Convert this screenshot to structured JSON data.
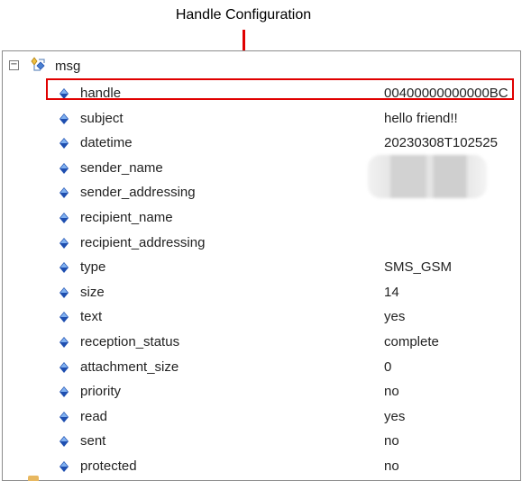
{
  "annotation": {
    "title": "Handle Configuration"
  },
  "tree": {
    "expander_symbol": "−",
    "root_label": "msg",
    "root_icon": "tree-node-icon",
    "property_icon": "blue-diamond-icon",
    "properties": [
      {
        "key": "handle",
        "value": "00400000000000BC",
        "highlighted": true
      },
      {
        "key": "subject",
        "value": "hello friend!!"
      },
      {
        "key": "datetime",
        "value": "20230308T102525"
      },
      {
        "key": "sender_name",
        "value": ""
      },
      {
        "key": "sender_addressing",
        "value": ""
      },
      {
        "key": "recipient_name",
        "value": ""
      },
      {
        "key": "recipient_addressing",
        "value": ""
      },
      {
        "key": "type",
        "value": "SMS_GSM"
      },
      {
        "key": "size",
        "value": "14"
      },
      {
        "key": "text",
        "value": "yes"
      },
      {
        "key": "reception_status",
        "value": "complete"
      },
      {
        "key": "attachment_size",
        "value": "0"
      },
      {
        "key": "priority",
        "value": "no"
      },
      {
        "key": "read",
        "value": "yes"
      },
      {
        "key": "sent",
        "value": "no"
      },
      {
        "key": "protected",
        "value": "no"
      }
    ]
  },
  "colors": {
    "highlight_border": "#e00000",
    "diamond_dark": "#1f4fb0",
    "diamond_light": "#7fb0f0"
  }
}
